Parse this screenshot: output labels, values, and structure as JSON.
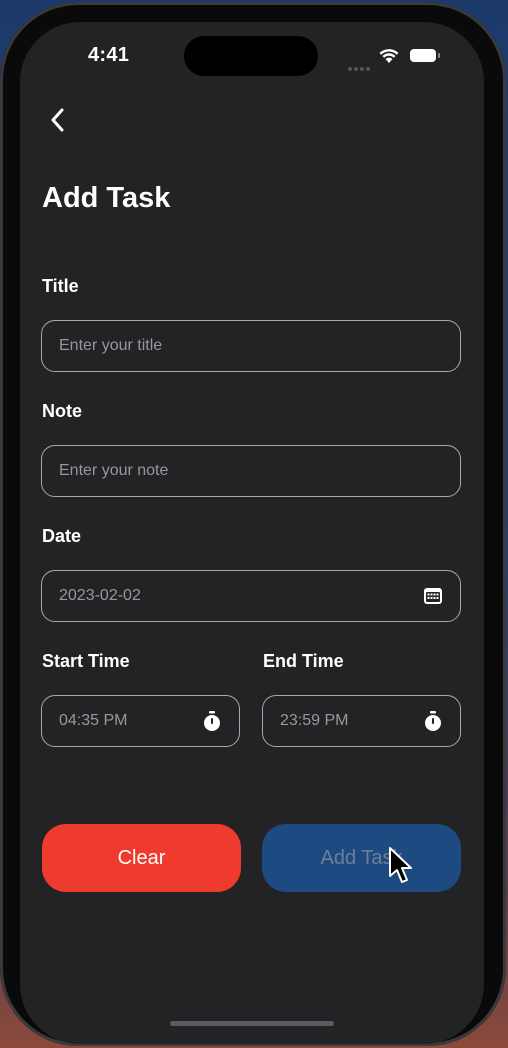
{
  "status_bar": {
    "time": "4:41"
  },
  "header": {
    "title": "Add Task"
  },
  "form": {
    "title": {
      "label": "Title",
      "placeholder": "Enter your title",
      "value": ""
    },
    "note": {
      "label": "Note",
      "placeholder": "Enter your note",
      "value": ""
    },
    "date": {
      "label": "Date",
      "value": "2023-02-02",
      "icon": "calendar-icon"
    },
    "start_time": {
      "label": "Start Time",
      "value": "04:35 PM",
      "icon": "stopwatch-icon"
    },
    "end_time": {
      "label": "End Time",
      "value": "23:59 PM",
      "icon": "stopwatch-icon"
    }
  },
  "buttons": {
    "clear": "Clear",
    "add_task": "Add Task"
  },
  "colors": {
    "background": "#232326",
    "clear_button": "#ef3b2d",
    "add_button": "#1d4a80",
    "field_border": "#a9a9ad"
  }
}
